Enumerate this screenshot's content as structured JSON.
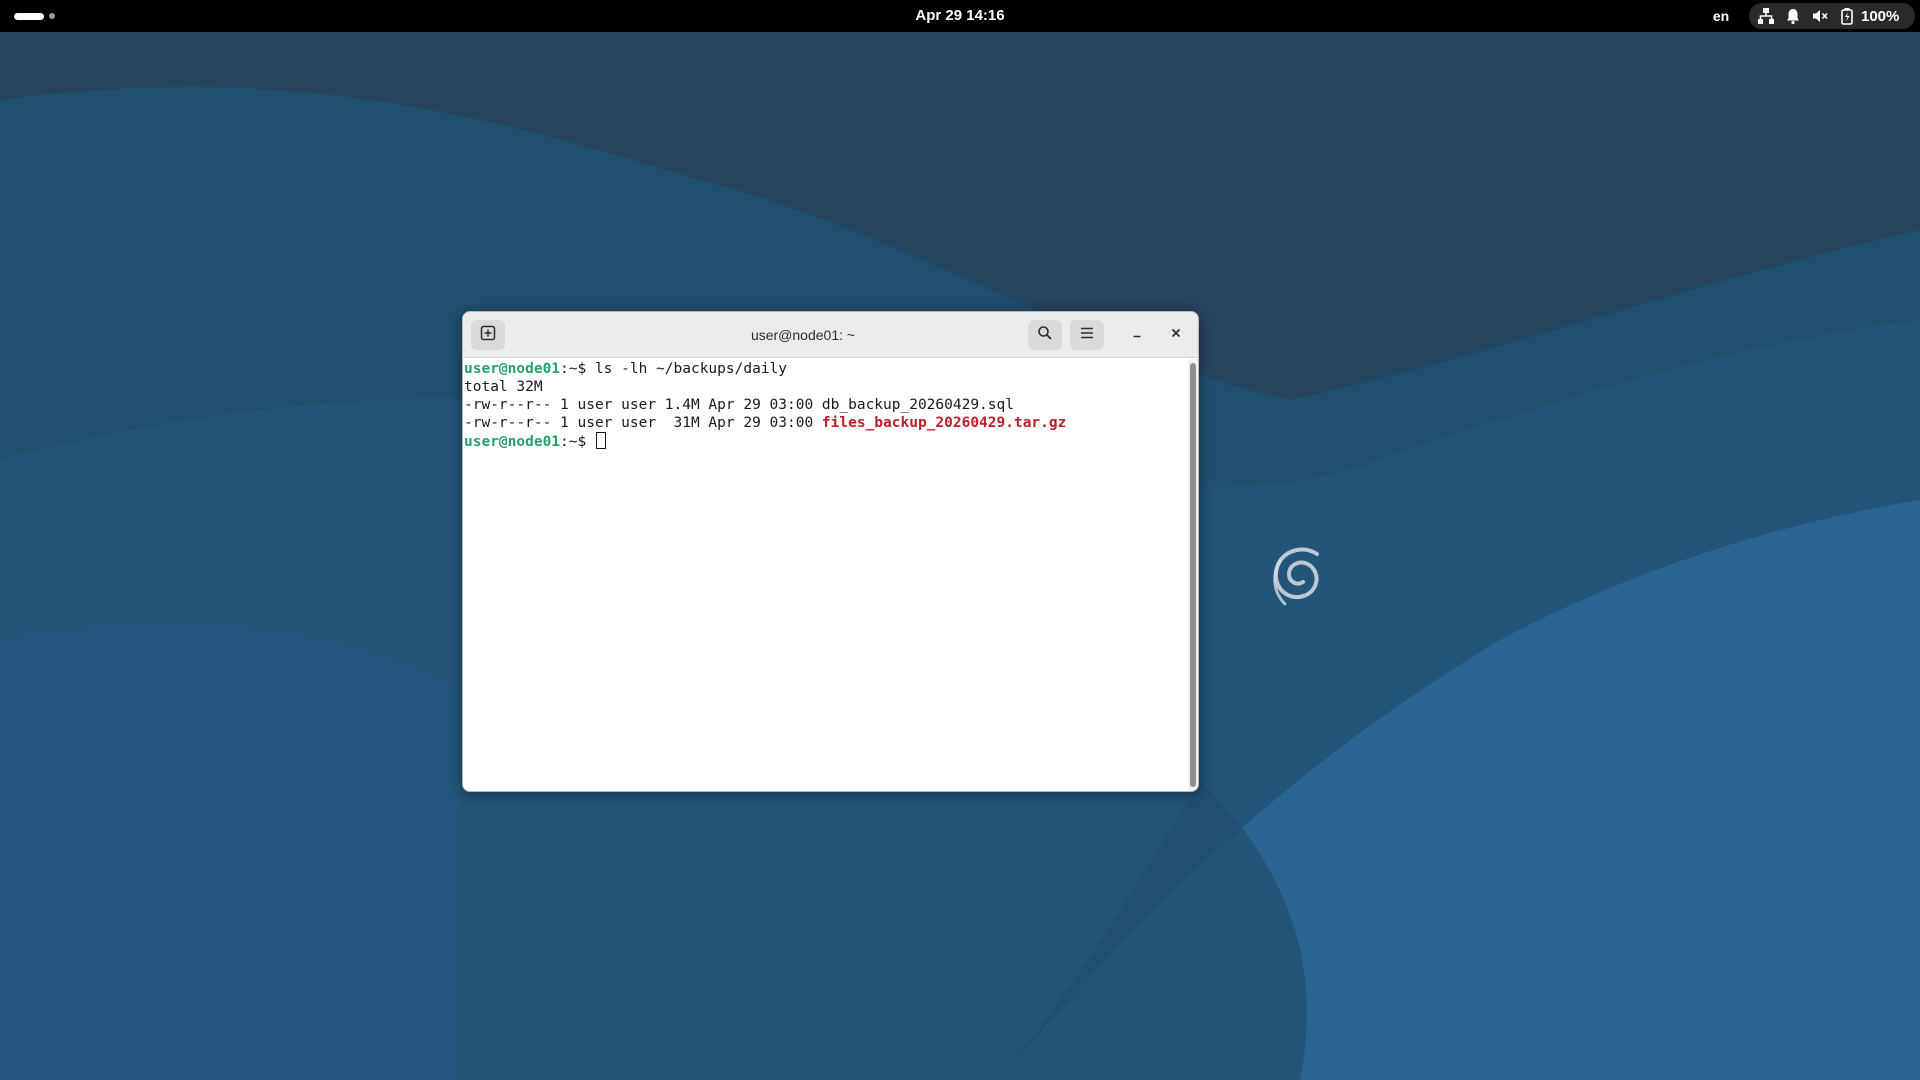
{
  "topbar": {
    "clock": "Apr 29  14:16",
    "language": "en",
    "battery_percent": "100%",
    "tray_icons": [
      "network-icon",
      "notification-bell-icon",
      "volume-muted-icon",
      "battery-icon"
    ]
  },
  "terminal": {
    "title": "user@node01: ~",
    "lines": {
      "l1_user": "user@node01",
      "l1_rest": ":~$ ls -lh ~/backups/daily",
      "l2": "total 32M",
      "l3": "-rw-r--r-- 1 user user 1.4M Apr 29 03:00 db_backup_20260429.sql",
      "l4_prefix": "-rw-r--r-- 1 user user  31M Apr 29 03:00 ",
      "l4_file": "files_backup_20260429.tar.gz",
      "l5_user": "user@node01",
      "l5_rest": ":~$ "
    }
  },
  "colors": {
    "prompt_user": "#26a269",
    "archive_file": "#c01c28",
    "topbar_bg": "#000000",
    "wallpaper_dark": "#1f4a6b",
    "wallpaper_light": "#2c6a97"
  }
}
